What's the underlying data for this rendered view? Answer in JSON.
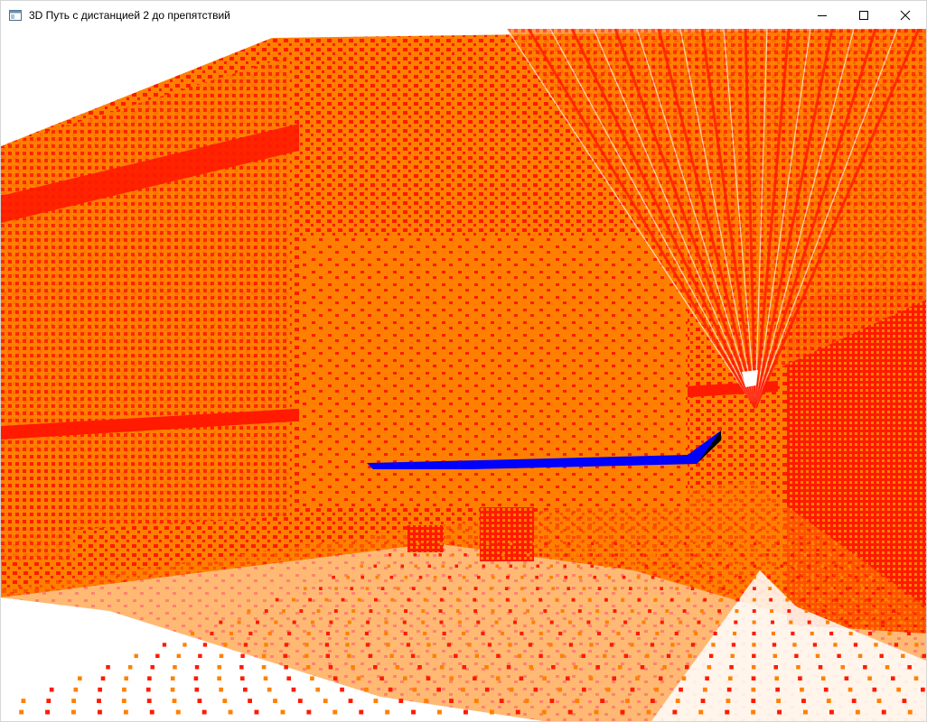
{
  "window": {
    "title": "3D Путь с дистанцией 2 до препятствий",
    "icons": {
      "app": "app-window-icon",
      "minimize": "minimize-icon",
      "maximize": "maximize-icon",
      "close": "close-icon"
    }
  },
  "scene": {
    "background": "#ffffff",
    "obstacle_colors": [
      "#ff8000",
      "#ff1a00"
    ],
    "path_color": "#0000ff",
    "path_shadow_color": "#000000"
  }
}
